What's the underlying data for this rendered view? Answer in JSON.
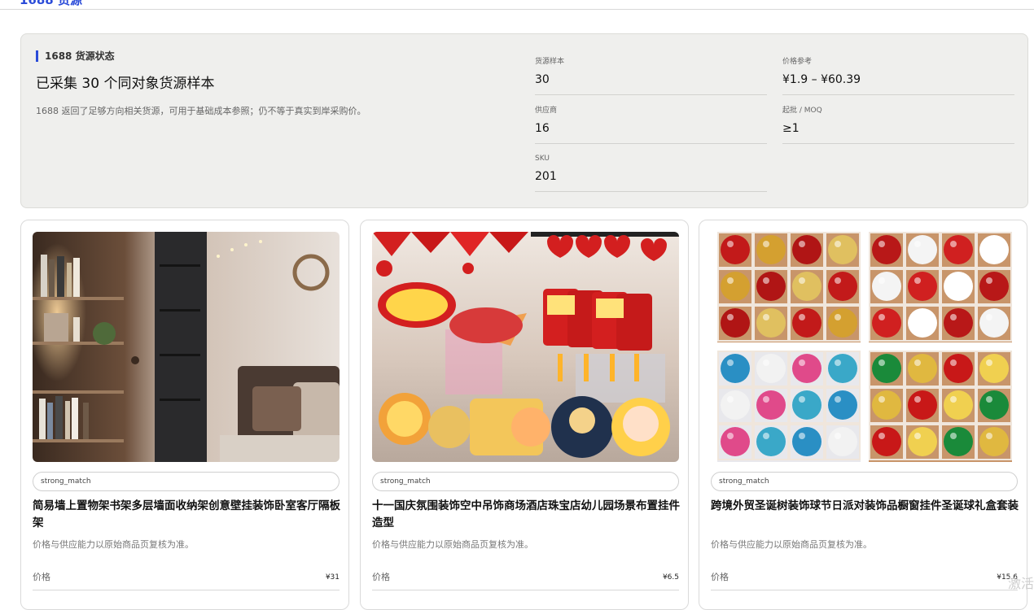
{
  "page": {
    "cut_title": "1688 货源"
  },
  "summary": {
    "kicker": "1688 货源状态",
    "headline": "已采集 30 个同对象货源样本",
    "description": "1688 返回了足够方向相关货源，可用于基础成本参照；仍不等于真实到岸采购价。",
    "stats": {
      "samples": {
        "label": "货源样本",
        "value": "30"
      },
      "price_ref": {
        "label": "价格参考",
        "value": "¥1.9 – ¥60.39"
      },
      "suppliers": {
        "label": "供应商",
        "value": "16"
      },
      "moq": {
        "label": "起批 / MOQ",
        "value": "≥1"
      },
      "sku": {
        "label": "SKU",
        "value": "201"
      }
    }
  },
  "cards": [
    {
      "badge": "strong_match",
      "title": "简易墙上置物架书架多层墙面收纳架创意壁挂装饰卧室客厅隔板架",
      "note": "价格与供应能力以原始商品页复核为准。",
      "price_label": "价格",
      "price": "¥31"
    },
    {
      "badge": "strong_match",
      "title": "十一国庆氛围装饰空中吊饰商场酒店珠宝店幼儿园场景布置挂件造型",
      "note": "价格与供应能力以原始商品页复核为准。",
      "price_label": "价格",
      "price": "¥6.5"
    },
    {
      "badge": "strong_match",
      "title": "跨境外贸圣诞树装饰球节日派对装饰品橱窗挂件圣诞球礼盒套装",
      "note": "价格与供应能力以原始商品页复核为准。",
      "price_label": "价格",
      "price": "¥15.6"
    }
  ],
  "watermark": "激活"
}
